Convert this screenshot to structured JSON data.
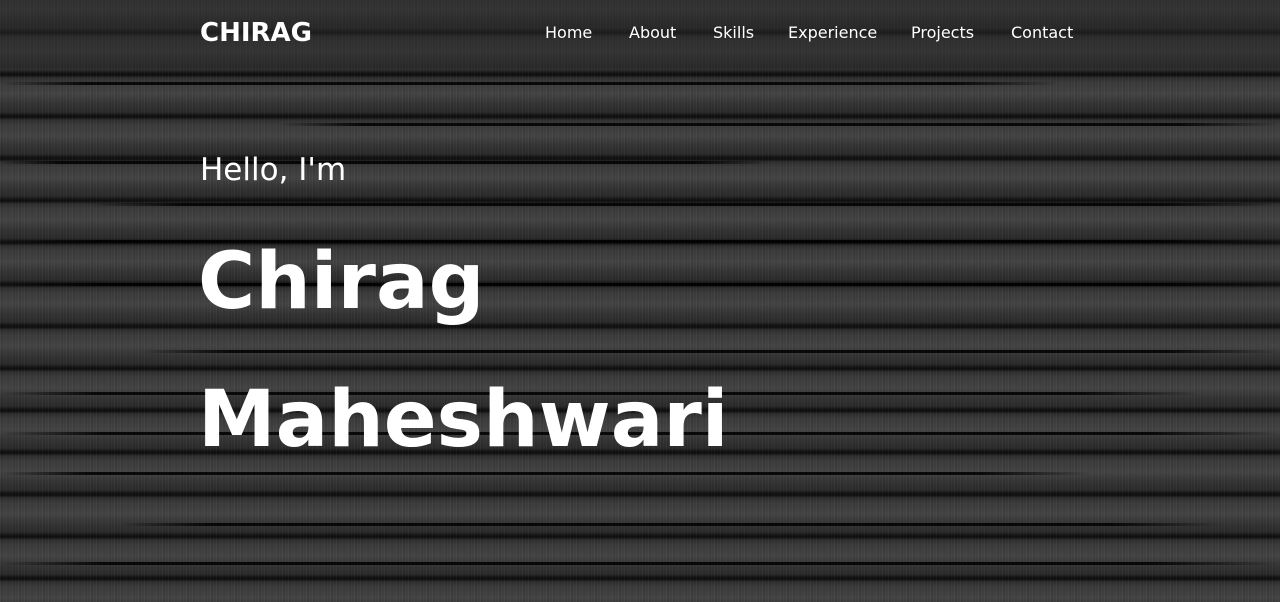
{
  "header": {
    "logo": "CHIRAG",
    "nav": [
      "Home",
      "About",
      "Skills",
      "Experience",
      "Projects",
      "Contact"
    ]
  },
  "hero": {
    "greeting": "Hello, I'm",
    "name_line1": "Chirag",
    "name_line2": "Maheshwari"
  },
  "colors": {
    "text": "#ffffff",
    "background": "#1a1a1a"
  }
}
